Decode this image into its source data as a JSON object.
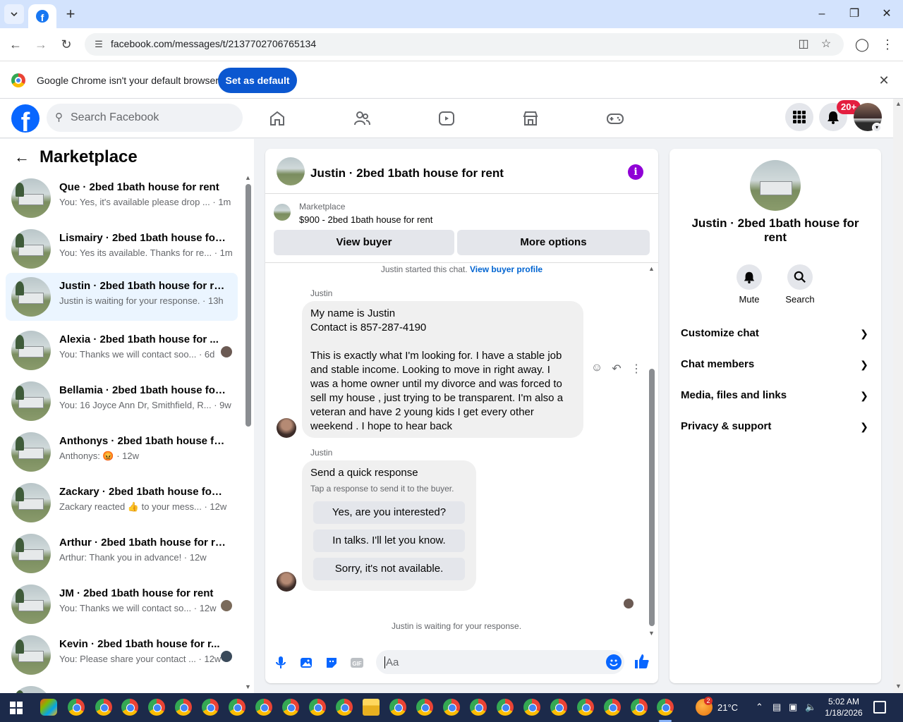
{
  "browser": {
    "url": "facebook.com/messages/t/2137702706765134",
    "infobar_text": "Google Chrome isn't your default browser",
    "set_default_label": "Set as default"
  },
  "fb_header": {
    "search_placeholder": "Search Facebook",
    "notification_count": "20+"
  },
  "sidebar": {
    "title": "Marketplace",
    "conversations": [
      {
        "name": "Que · 2bed 1bath house for rent",
        "preview": "You: Yes, it's available please drop ... · 1m",
        "active": false
      },
      {
        "name": "Lismairy · 2bed 1bath house for ...",
        "preview": "You: Yes its available. Thanks for re... · 1m",
        "active": false
      },
      {
        "name": "Justin · 2bed 1bath house for rent",
        "preview": "Justin is waiting for your response. · 13h",
        "active": true
      },
      {
        "name": "Alexia · 2bed 1bath house for ...",
        "preview": "You: Thanks we will contact soo... · 6d",
        "active": false
      },
      {
        "name": "Bellamia · 2bed 1bath house for ...",
        "preview": "You: 16 Joyce Ann Dr, Smithfield, R... · 9w",
        "active": false
      },
      {
        "name": "Anthonys · 2bed 1bath house fo...",
        "preview": "Anthonys: 😡 · 12w",
        "active": false
      },
      {
        "name": "Zackary · 2bed 1bath house for r...",
        "preview": "Zackary reacted 👍 to your mess... · 12w",
        "active": false
      },
      {
        "name": "Arthur · 2bed 1bath house for rent",
        "preview": "Arthur: Thank you in advance! · 12w",
        "active": false
      },
      {
        "name": "JM · 2bed 1bath house for rent",
        "preview": "You: Thanks we will contact so... · 12w",
        "active": false
      },
      {
        "name": "Kevin · 2bed 1bath house for r...",
        "preview": "You: Please share your contact ... · 12w",
        "active": false
      }
    ]
  },
  "chat": {
    "title": "Justin · 2bed 1bath house for rent",
    "listing_label": "Marketplace",
    "listing_price_title": "$900 - 2bed 1bath house for rent",
    "view_buyer_label": "View buyer",
    "more_options_label": "More options",
    "started_text": "Justin started this chat.",
    "view_buyer_profile_label": "View buyer profile",
    "sender_name": "Justin",
    "message_lines": [
      "My name is Justin",
      "Contact is 857-287-4190",
      "",
      "This is exactly what I'm looking for.  I have a stable job",
      "and stable income.  Looking to move in right away.  I",
      "was a home owner until my divorce and was forced to",
      "sell my house , just trying to be transparent. I'm also a",
      "veteran and have 2 young kids I get every other",
      "weekend .  I hope to hear back"
    ],
    "quick_response_title": "Send a quick response",
    "quick_response_sub": "Tap a response to send it to the buyer.",
    "quick_responses": [
      "Yes, are you interested?",
      "In talks. I'll let you know.",
      "Sorry, it's not available."
    ],
    "waiting_text": "Justin is waiting for your response.",
    "composer_placeholder": "Aa"
  },
  "details": {
    "title": "Justin · 2bed 1bath house for rent",
    "mute_label": "Mute",
    "search_label": "Search",
    "rows": [
      "Customize chat",
      "Chat members",
      "Media, files and links",
      "Privacy & support"
    ]
  },
  "taskbar": {
    "temperature": "21°C",
    "weather_badge": "2",
    "time": "5:02 AM",
    "date": "1/18/2026"
  }
}
